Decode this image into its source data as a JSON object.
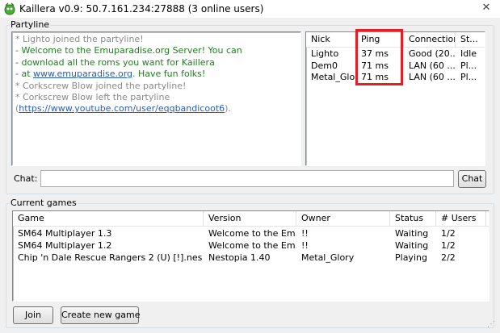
{
  "window": {
    "title": "Kaillera v0.9: 50.7.161.234:27888 (3 online users)",
    "close_icon": "close-icon"
  },
  "partyline": {
    "label": "Partyline",
    "messages": [
      {
        "text": "* Lighto joined the partyline!",
        "style": "gray"
      },
      {
        "text": "- Welcome to the Emuparadise.org Server! You can",
        "style": "green"
      },
      {
        "text": "- download all the roms you want for Kaillera",
        "style": "green"
      },
      {
        "prefix": "- at ",
        "link": "www.emuparadise.org",
        "suffix": ". Have fun folks!",
        "style": "green"
      },
      {
        "text": "* Corkscrew Blow joined the partyline!",
        "style": "gray"
      },
      {
        "text": "* Corkscrew Blow left the partyline",
        "style": "gray"
      },
      {
        "prefix": "(",
        "link": "https://www.youtube.com/user/eqqbandicoot6",
        "suffix": ").",
        "style": "gray"
      }
    ],
    "users": {
      "columns": [
        "Nick",
        "Ping",
        "Connection",
        "St..."
      ],
      "rows": [
        [
          "Lighto",
          "37 ms",
          "Good (20...",
          "Idle"
        ],
        [
          "Dem0",
          "71 ms",
          "LAN (60 ...",
          "Pl..."
        ],
        [
          "Metal_Glory",
          "71 ms",
          "LAN (60 ...",
          "Pl..."
        ]
      ]
    },
    "highlight_color": "#e31e25",
    "chat_label": "Chat:",
    "chat_value": "",
    "chat_button": "Chat"
  },
  "current_games": {
    "label": "Current games",
    "columns": [
      "Game",
      "Version",
      "Owner",
      "Status",
      "# Users"
    ],
    "rows": [
      [
        "SM64 Multiplayer 1.3",
        "Welcome to the Em...",
        "!!",
        "Waiting",
        "1/2"
      ],
      [
        "SM64 Multiplayer 1.2",
        "Welcome to the Em...",
        "!!",
        "Waiting",
        "1/2"
      ],
      [
        "Chip 'n Dale Rescue Rangers 2 (U) [!].nes",
        "Nestopia 1.40",
        "Metal_Glory",
        "Playing",
        "2/2"
      ]
    ],
    "join_button": "Join",
    "create_button": "Create new game"
  }
}
